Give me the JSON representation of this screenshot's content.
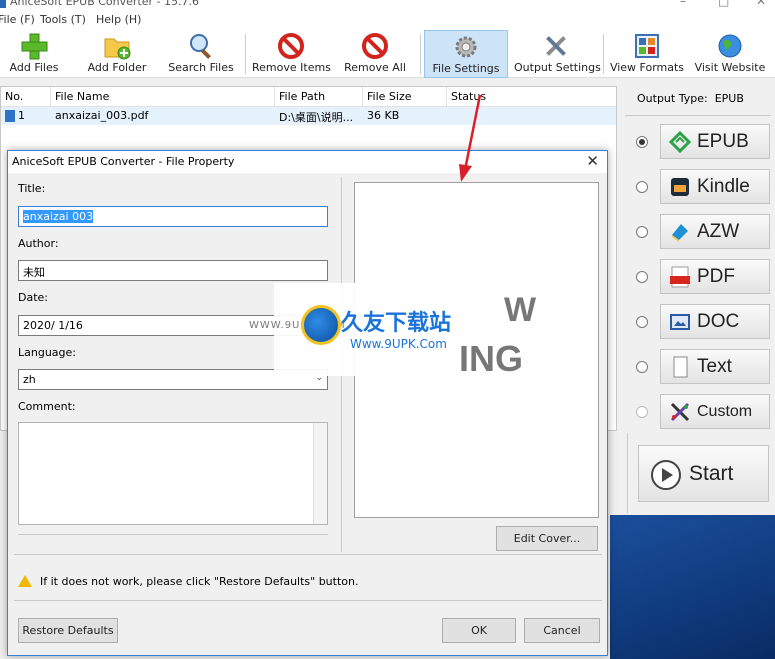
{
  "window": {
    "title": "AniceSoft EPUB Converter - 15.7.6"
  },
  "menu": [
    "File (F)",
    "Tools (T)",
    "Help (H)"
  ],
  "toolbar": [
    {
      "id": "add-files",
      "label": "Add Files",
      "icon": "add-icon"
    },
    {
      "id": "add-folder",
      "label": "Add Folder",
      "icon": "folder-add-icon"
    },
    {
      "id": "search-files",
      "label": "Search Files",
      "icon": "search-icon"
    },
    {
      "id": "remove-items",
      "label": "Remove Items",
      "icon": "remove-icon"
    },
    {
      "id": "remove-all",
      "label": "Remove All",
      "icon": "remove-all-icon"
    },
    {
      "id": "file-settings",
      "label": "File Settings",
      "icon": "settings-icon"
    },
    {
      "id": "output-settings",
      "label": "Output Settings",
      "icon": "tools-icon"
    },
    {
      "id": "view-formats",
      "label": "View Formats",
      "icon": "formats-icon"
    },
    {
      "id": "visit-website",
      "label": "Visit Website",
      "icon": "globe-icon"
    }
  ],
  "filelist": {
    "columns": [
      "No.",
      "File Name",
      "File Path",
      "File Size",
      "Status"
    ],
    "rows": [
      {
        "no": "1",
        "name": "anxaizai_003.pdf",
        "path": "D:\\桌面\\说明...",
        "size": "36 KB",
        "status": ""
      }
    ]
  },
  "output": {
    "label": "Output Type:",
    "value": "EPUB",
    "formats": [
      {
        "label": "EPUB",
        "selected": true,
        "icon": "epub-icon",
        "color": "#2ba245"
      },
      {
        "label": "Kindle",
        "selected": false,
        "icon": "kindle-icon",
        "color": "#1f2c3a"
      },
      {
        "label": "AZW",
        "selected": false,
        "icon": "azw-icon",
        "color": "#1f8fd6"
      },
      {
        "label": "PDF",
        "selected": false,
        "icon": "pdf-icon",
        "color": "#d9261c"
      },
      {
        "label": "DOC",
        "selected": false,
        "icon": "doc-icon",
        "color": "#2a5aa8"
      },
      {
        "label": "Text",
        "selected": false,
        "icon": "text-icon",
        "color": "#888888"
      },
      {
        "label": "Custom",
        "selected": false,
        "icon": "custom-icon",
        "color": "#6a3fb0"
      }
    ],
    "start_label": "Start"
  },
  "dialog": {
    "title": "AniceSoft EPUB Converter - File Property",
    "title_label": "Title:",
    "title_value": "anxaizai 003",
    "author_label": "Author:",
    "author_value": "未知",
    "date_label": "Date:",
    "date_value": "2020/  1/16",
    "language_label": "Language:",
    "language_value": "zh",
    "comment_label": "Comment:",
    "comment_value": "",
    "edit_cover": "Edit Cover...",
    "warning": "If it does not work, please click \"Restore Defaults\" button.",
    "restore": "Restore Defaults",
    "ok": "OK",
    "cancel": "Cancel"
  },
  "watermark": {
    "brand": "久友下载站",
    "url": "Www.9UPK.Com",
    "site": "WWW.9UPK.COM",
    "ghost1": "W",
    "ghost2": "ING"
  },
  "colors": {
    "accent": "#3399ff",
    "dialog_border": "#3b7dd8",
    "arrow": "#d8202a"
  }
}
